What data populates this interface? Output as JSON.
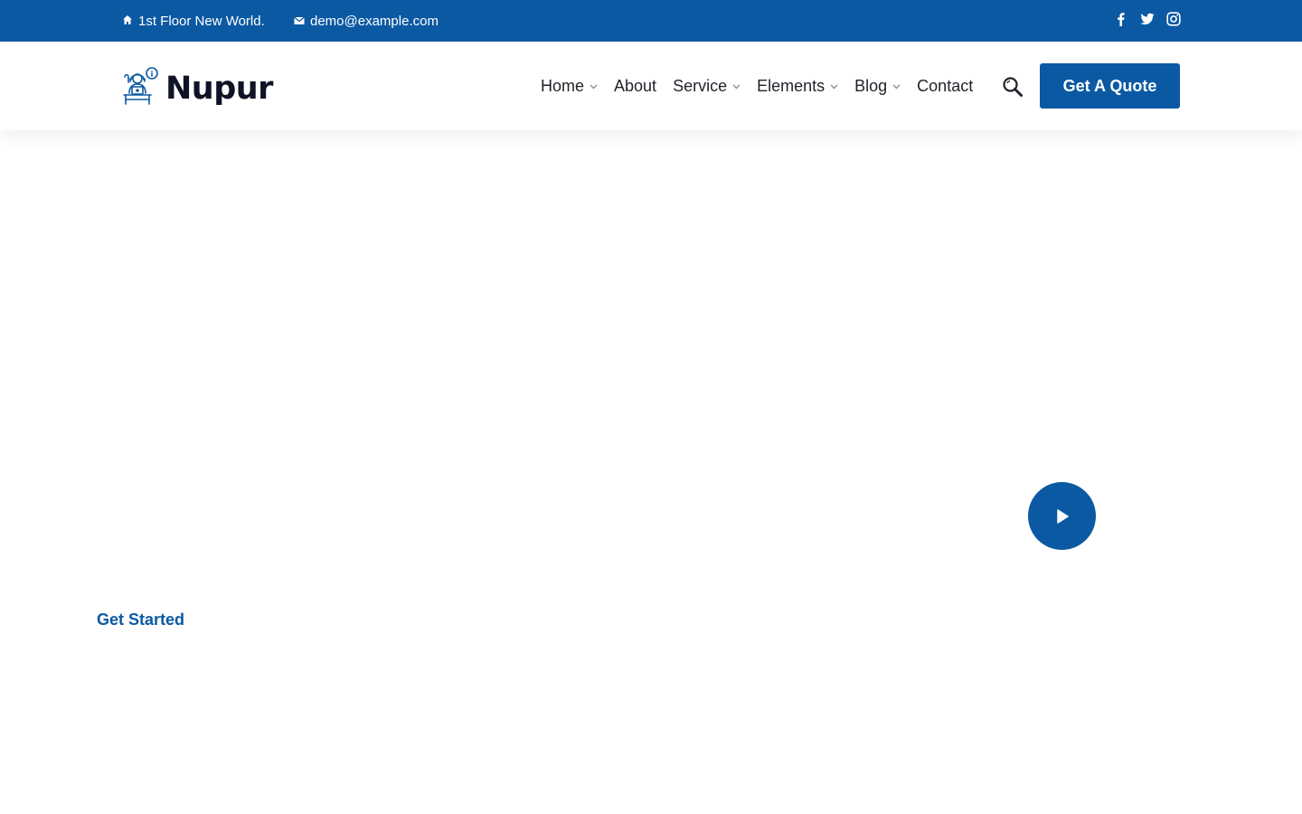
{
  "topbar": {
    "address": "1st Floor New World.",
    "email": "demo@example.com",
    "social": [
      "facebook-icon",
      "twitter-icon",
      "instagram-icon"
    ]
  },
  "header": {
    "logo_text": "Nupur",
    "nav": [
      {
        "label": "Home",
        "has_dropdown": true
      },
      {
        "label": "About",
        "has_dropdown": false
      },
      {
        "label": "Service",
        "has_dropdown": true
      },
      {
        "label": "Elements",
        "has_dropdown": true
      },
      {
        "label": "Blog",
        "has_dropdown": true
      },
      {
        "label": "Contact",
        "has_dropdown": false
      }
    ],
    "cta_label": "Get A Quote"
  },
  "hero": {
    "cta_label": "Get Started"
  },
  "colors": {
    "brand": "#0c59a3",
    "text_dark": "#1f2229",
    "logo_text": "#101326"
  }
}
